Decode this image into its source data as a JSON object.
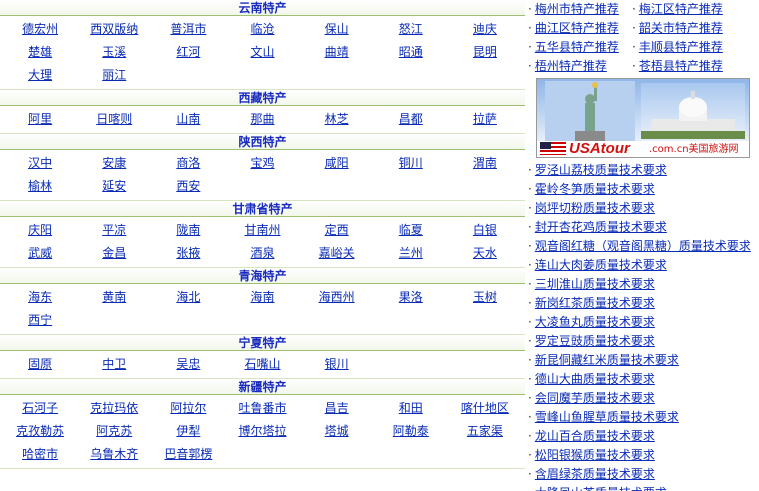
{
  "sections": [
    {
      "title": "云南特产",
      "items": [
        "德宏州",
        "西双版纳",
        "普洱市",
        "临沧",
        "保山",
        "怒江",
        "迪庆",
        "楚雄",
        "玉溪",
        "红河",
        "文山",
        "曲靖",
        "昭通",
        "昆明",
        "大理",
        "丽江"
      ]
    },
    {
      "title": "西藏特产",
      "items": [
        "阿里",
        "日喀则",
        "山南",
        "那曲",
        "林芝",
        "昌都",
        "拉萨"
      ]
    },
    {
      "title": "陕西特产",
      "items": [
        "汉中",
        "安康",
        "商洛",
        "宝鸡",
        "咸阳",
        "铜川",
        "渭南",
        "榆林",
        "延安",
        "西安"
      ]
    },
    {
      "title": "甘肃省特产",
      "items": [
        "庆阳",
        "平凉",
        "陇南",
        "甘南州",
        "定西",
        "临夏",
        "白银",
        "武威",
        "金昌",
        "张掖",
        "酒泉",
        "嘉峪关",
        "兰州",
        "天水"
      ]
    },
    {
      "title": "青海特产",
      "items": [
        "海东",
        "黄南",
        "海北",
        "海南",
        "海西州",
        "果洛",
        "玉树",
        "西宁"
      ]
    },
    {
      "title": "宁夏特产",
      "items": [
        "固原",
        "中卫",
        "吴忠",
        "石嘴山",
        "银川"
      ]
    },
    {
      "title": "新疆特产",
      "items": [
        "石河子",
        "克拉玛依",
        "阿拉尔",
        "吐鲁番市",
        "昌吉",
        "和田",
        "喀什地区",
        "克孜勒苏",
        "阿克苏",
        "伊犁",
        "博尔塔拉",
        "塔城",
        "阿勒泰",
        "五家渠",
        "哈密市",
        "乌鲁木齐",
        "巴音郭楞"
      ]
    }
  ],
  "right_top": [
    [
      "梅州市特产推荐",
      "梅江区特产推荐"
    ],
    [
      "曲江区特产推荐",
      "韶关市特产推荐"
    ],
    [
      "五华县特产推荐",
      "丰顺县特产推荐"
    ],
    [
      "梧州特产推荐",
      "苍梧县特产推荐"
    ]
  ],
  "banner": {
    "brand": "USAtour",
    "sub": ".com.cn美国旅游网"
  },
  "standards": [
    "罗泾山荔枝质量技术要求",
    "霍岭冬笋质量技术要求",
    "岗坪切粉质量技术要求",
    "封开杏花鸡质量技术要求",
    "观音阁红糖（观音阁黑糖）质量技术要求",
    "连山大肉姜质量技术要求",
    "三圳淮山质量技术要求",
    "新岗红茶质量技术要求",
    "大凌鱼丸质量技术要求",
    "罗定豆豉质量技术要求",
    "新昆侗藏红米质量技术要求",
    "德山大曲质量技术要求",
    "会同魔芋质量技术要求",
    "雪峰山鱼腥草质量技术要求",
    "龙山百合质量技术要求",
    "松阳银猴质量技术要求",
    "含眉绿茶质量技术要求",
    "大隆凤山茶质量技术要求"
  ],
  "colors": {
    "link": "#0a2bb5",
    "heading": "#1a2cc0",
    "divider": "#9fbf75"
  }
}
